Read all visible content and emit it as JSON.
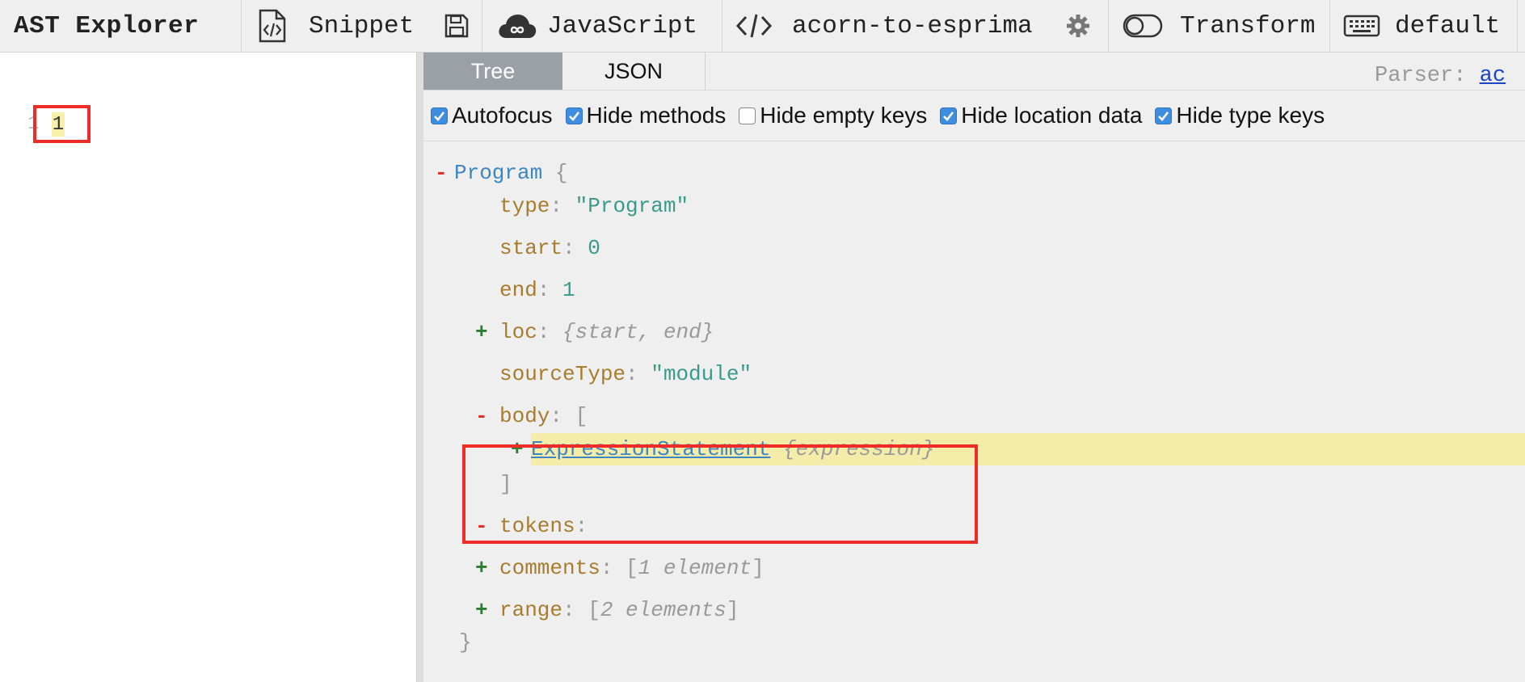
{
  "toolbar": {
    "title": "AST Explorer",
    "snippet_label": "Snippet",
    "language_label": "JavaScript",
    "parser_label": "acorn-to-esprima",
    "transform_label": "Transform",
    "keymap_label": "default",
    "icons": [
      "snippet-file-icon",
      "save-icon",
      "cloud-icon",
      "code-icon",
      "gear-icon",
      "toggle-icon",
      "keyboard-icon"
    ]
  },
  "editor": {
    "line_number": "1",
    "code": "1"
  },
  "output": {
    "tabs": {
      "tree": "Tree",
      "json": "JSON"
    },
    "parser": {
      "label": "Parser:",
      "link": "ac"
    },
    "options": [
      {
        "label": "Autofocus",
        "checked": true
      },
      {
        "label": "Hide methods",
        "checked": true
      },
      {
        "label": "Hide empty keys",
        "checked": false
      },
      {
        "label": "Hide location data",
        "checked": true
      },
      {
        "label": "Hide type keys",
        "checked": true
      }
    ],
    "tree": {
      "root_name": "Program",
      "open_brace": "{",
      "close_brace": "}",
      "type_key": "type",
      "type_value": "\"Program\"",
      "start_key": "start",
      "start_value": "0",
      "end_key": "end",
      "end_value": "1",
      "loc_key": "loc",
      "loc_summary": "start, end",
      "source_type_key": "sourceType",
      "source_type_value": "\"module\"",
      "body_key": "body",
      "expr_name": "ExpressionStatement",
      "expr_summary": "expression",
      "tokens_key": "tokens",
      "comments_key": "comments",
      "comments_summary": "1 element",
      "range_key": "range",
      "range_summary": "2 elements"
    }
  },
  "colors": {
    "highlight_box": "#ef2b25",
    "tab_active": "#9aa0a6",
    "checkbox": "#3f8de0",
    "key": "#a97b2d",
    "node_type": "#3d86c4",
    "string": "#3a9a8c",
    "row_highlight": "#f5eca9"
  }
}
